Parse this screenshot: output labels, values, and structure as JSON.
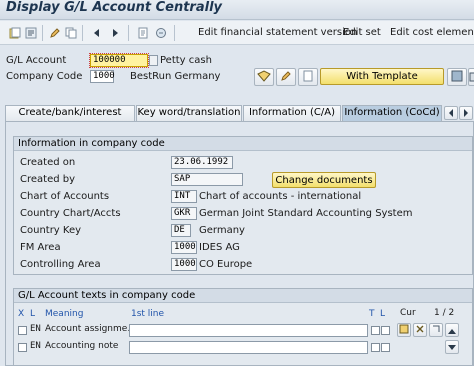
{
  "window": {
    "title": "Display G/L Account Centrally"
  },
  "toolbar": {
    "icons": [
      "other-object-icon",
      "where-used-icon",
      "display-change-icon",
      "previous-icon",
      "next-icon",
      "copy-icon"
    ],
    "actions": [
      "Edit financial statement version",
      "Edit set",
      "Edit cost element"
    ]
  },
  "header": {
    "gl_account_label": "G/L Account",
    "gl_account_value": "100000",
    "gl_account_desc": "Petty cash",
    "company_code_label": "Company Code",
    "company_code_value": "1000",
    "company_code_desc": "BestRun Germany",
    "with_template_label": "With Template"
  },
  "tabs": [
    {
      "label": "Create/bank/interest",
      "active": false
    },
    {
      "label": "Key word/translation",
      "active": false
    },
    {
      "label": "Information (C/A)",
      "active": false
    },
    {
      "label": "Information (CoCd)",
      "active": true
    }
  ],
  "info_group": {
    "title": "Information in company code",
    "rows": [
      {
        "label": "Created on",
        "value": "23.06.1992",
        "desc": ""
      },
      {
        "label": "Created by",
        "value": "SAP",
        "desc": ""
      },
      {
        "label": "Chart of Accounts",
        "value": "INT",
        "desc": "Chart of accounts - international"
      },
      {
        "label": "Country Chart/Accts",
        "value": "GKR",
        "desc": "German Joint Standard Accounting System"
      },
      {
        "label": "Country Key",
        "value": "DE",
        "desc": "Germany"
      },
      {
        "label": "FM Area",
        "value": "1000",
        "desc": "IDES AG"
      },
      {
        "label": "Controlling Area",
        "value": "1000",
        "desc": "CO Europe"
      }
    ],
    "change_documents_label": "Change documents"
  },
  "texts_group": {
    "title": "G/L Account texts in company code",
    "headers": {
      "x": "X",
      "l": "L",
      "meaning": "Meaning",
      "first_line": "1st line",
      "t": "T",
      "l2": "L",
      "cur": "Cur",
      "page": "1 / 2"
    },
    "rows": [
      {
        "lang": "EN",
        "meaning": "Account assignme…",
        "first_line": ""
      },
      {
        "lang": "EN",
        "meaning": "Accounting note",
        "first_line": ""
      }
    ]
  },
  "colors": {
    "background": "#dfe6ee",
    "active_tab": "#b9cde0",
    "yellow_button": "#f3df6c"
  }
}
